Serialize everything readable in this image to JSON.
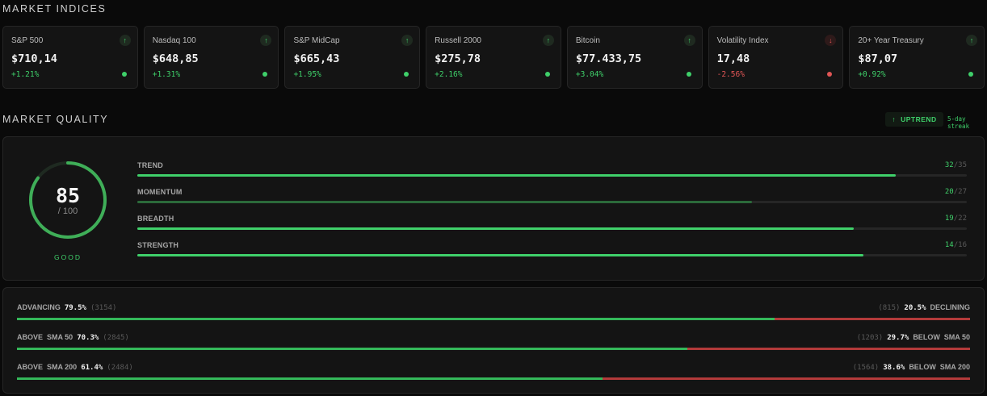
{
  "indices": {
    "title": "MARKET INDICES",
    "cards": [
      {
        "name": "S&P 500",
        "price": "$710,14",
        "change": "+1.21%",
        "direction": "up"
      },
      {
        "name": "Nasdaq 100",
        "price": "$648,85",
        "change": "+1.31%",
        "direction": "up"
      },
      {
        "name": "S&P MidCap",
        "price": "$665,43",
        "change": "+1.95%",
        "direction": "up"
      },
      {
        "name": "Russell 2000",
        "price": "$275,78",
        "change": "+2.16%",
        "direction": "up"
      },
      {
        "name": "Bitcoin",
        "price": "$77.433,75",
        "change": "+3.04%",
        "direction": "up"
      },
      {
        "name": "Volatility Index",
        "price": "17,48",
        "change": "-2.56%",
        "direction": "down"
      },
      {
        "name": "20+ Year Treasury",
        "price": "$87,07",
        "change": "+0.92%",
        "direction": "up"
      }
    ]
  },
  "quality": {
    "title": "MARKET QUALITY",
    "trend_label": "UPTREND",
    "streak": "5-day streak",
    "score": "85",
    "score_max": "/ 100",
    "grade": "GOOD",
    "score_fraction": 0.85,
    "metrics": [
      {
        "label": "TREND",
        "value": "32",
        "max": "/35",
        "fraction": 0.914,
        "strong": true
      },
      {
        "label": "MOMENTUM",
        "value": "20",
        "max": "/27",
        "fraction": 0.741,
        "strong": false
      },
      {
        "label": "BREADTH",
        "value": "19",
        "max": "/22",
        "fraction": 0.864,
        "strong": true
      },
      {
        "label": "STRENGTH",
        "value": "14",
        "max": "/16",
        "fraction": 0.875,
        "strong": true
      }
    ]
  },
  "breadth": {
    "rows": [
      {
        "left_label": "ADVANCING",
        "left_pct": "79.5%",
        "left_count": "(3154)",
        "right_count": "(815)",
        "right_pct": "20.5%",
        "right_label": "DECLINING",
        "fraction": 0.795
      },
      {
        "left_label": "ABOVE  SMA 50",
        "left_pct": "70.3%",
        "left_count": "(2845)",
        "right_count": "(1203)",
        "right_pct": "29.7%",
        "right_label": "BELOW  SMA 50",
        "fraction": 0.703
      },
      {
        "left_label": "ABOVE  SMA 200",
        "left_pct": "61.4%",
        "left_count": "(2484)",
        "right_count": "(1564)",
        "right_pct": "38.6%",
        "right_label": "BELOW  SMA 200",
        "fraction": 0.614
      }
    ]
  },
  "colors": {
    "positive": "#3fd06a",
    "negative": "#e05555",
    "background": "#0a0a0a",
    "panel": "#141414"
  }
}
